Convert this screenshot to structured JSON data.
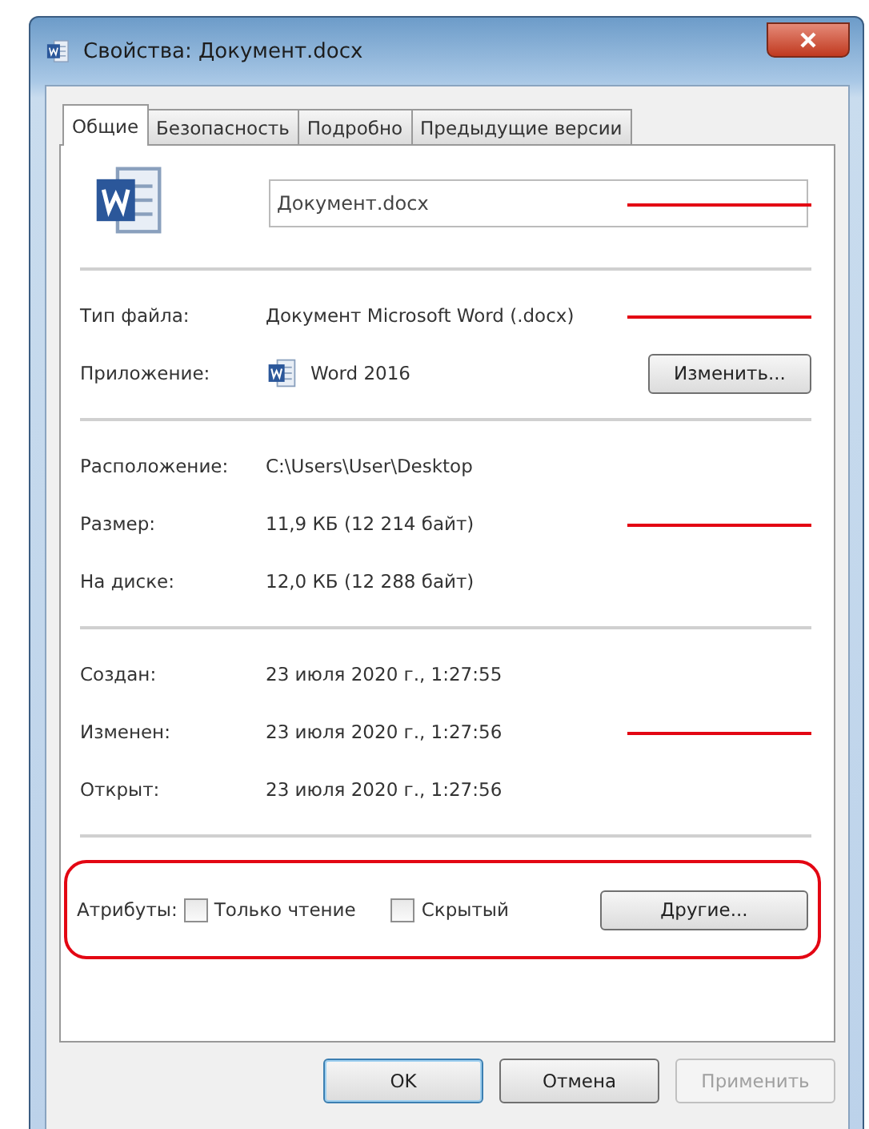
{
  "window": {
    "title": "Свойства: Документ.docx"
  },
  "tabs": [
    {
      "label": "Общие",
      "selected": true
    },
    {
      "label": "Безопасность",
      "selected": false
    },
    {
      "label": "Подробно",
      "selected": false
    },
    {
      "label": "Предыдущие версии",
      "selected": false
    }
  ],
  "file_name": {
    "value": "Документ.docx",
    "marked": true
  },
  "sections": [
    {
      "rows": [
        {
          "label": "Тип файла:",
          "value": "Документ Microsoft Word (.docx)",
          "kind": "text",
          "marked": true
        },
        {
          "label": "Приложение:",
          "value": "Word 2016",
          "kind": "app",
          "button": "Изменить...",
          "marked": false
        }
      ]
    },
    {
      "rows": [
        {
          "label": "Расположение:",
          "value": "C:\\Users\\User\\Desktop",
          "kind": "text",
          "marked": false
        },
        {
          "label": "Размер:",
          "value": "11,9 КБ (12 214 байт)",
          "kind": "text",
          "marked": true
        },
        {
          "label": "На диске:",
          "value": "12,0 КБ (12 288 байт)",
          "kind": "text",
          "marked": false
        }
      ]
    },
    {
      "rows": [
        {
          "label": "Создан:",
          "value": "23 июля 2020 г., 1:27:55",
          "kind": "text",
          "marked": false
        },
        {
          "label": "Изменен:",
          "value": "23 июля 2020 г., 1:27:56",
          "kind": "text",
          "marked": true
        },
        {
          "label": "Открыт:",
          "value": "23 июля 2020 г., 1:27:56",
          "kind": "text",
          "marked": false
        }
      ]
    }
  ],
  "attributes": {
    "label": "Атрибуты:",
    "highlighted": true,
    "checkboxes": [
      {
        "label": "Только чтение",
        "checked": false
      },
      {
        "label": "Скрытый",
        "checked": false
      }
    ],
    "button": "Другие..."
  },
  "buttons": [
    {
      "label": "OK",
      "default": true,
      "disabled": false
    },
    {
      "label": "Отмена",
      "default": false,
      "disabled": false
    },
    {
      "label": "Применить",
      "default": false,
      "disabled": true
    }
  ]
}
